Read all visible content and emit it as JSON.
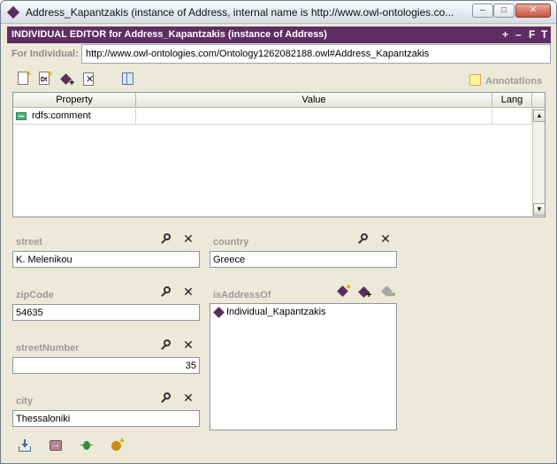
{
  "window": {
    "title": "Address_Kapantzakis   (instance of Address, internal name is http://www.owl-ontologies.co...",
    "min_label": "–",
    "max_label": "□",
    "close_label": "✕"
  },
  "editor": {
    "header_title": "INDIVIDUAL EDITOR for Address_Kapantzakis   (instance of Address)",
    "header_controls": [
      "+",
      "–",
      "F",
      "T"
    ],
    "for_label": "For Individual:",
    "iri": "http://www.owl-ontologies.com/Ontology1262082188.owl#Address_Kapantzakis"
  },
  "toolbar": {
    "icons": [
      "create-annotation-icon",
      "create-datatype-annotation-icon",
      "add-instance-annotation-icon",
      "delete-annotation-icon",
      "view-columns-icon"
    ]
  },
  "annotations_label": "Annotations",
  "table": {
    "columns": [
      "Property",
      "Value",
      "Lang"
    ],
    "rows": [
      {
        "property": "rdfs:comment",
        "value": "",
        "lang": ""
      }
    ]
  },
  "fields": {
    "street": {
      "label": "street",
      "value": "K. Melenikou"
    },
    "country": {
      "label": "country",
      "value": "Greece"
    },
    "zipCode": {
      "label": "zipCode",
      "value": "54635"
    },
    "isAddressOf": {
      "label": "isAddressOf",
      "items": [
        "Individual_Kapantzakis"
      ]
    },
    "streetNumber": {
      "label": "streetNumber",
      "value": "35"
    },
    "city": {
      "label": "city",
      "value": "Thessaloniki"
    }
  },
  "icons": {
    "find": "search-icon",
    "delete": "delete-icon",
    "accent": "#5e2d62"
  }
}
